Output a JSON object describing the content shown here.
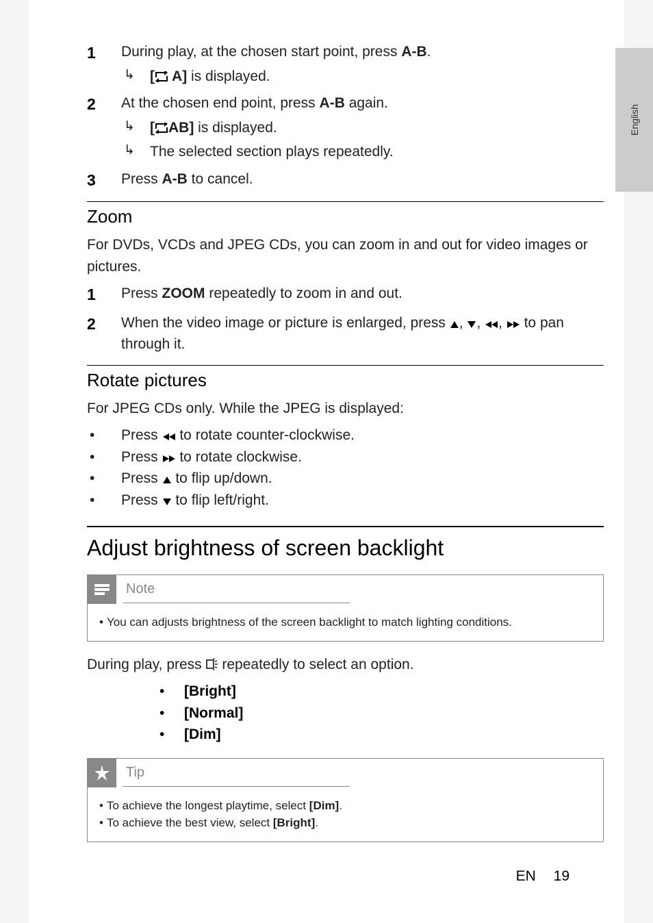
{
  "lang_tab": "English",
  "steps_a": [
    {
      "num": "1",
      "text_pre": "During play, at the chosen start point, press ",
      "text_bold": "A-B",
      "text_post": ".",
      "results": [
        {
          "pre": "[",
          "icon": "repeat",
          "mid": " A]",
          "post": " is displayed."
        }
      ]
    },
    {
      "num": "2",
      "text_pre": "At the chosen end point, press ",
      "text_bold": "A-B",
      "text_post": " again.",
      "results": [
        {
          "pre": "[",
          "icon": "repeat",
          "mid": "AB]",
          "post": " is displayed."
        },
        {
          "plain": "The selected section plays repeatedly."
        }
      ]
    },
    {
      "num": "3",
      "text_pre": "Press ",
      "text_bold": "A-B",
      "text_post": " to cancel.",
      "results": []
    }
  ],
  "zoom": {
    "heading": "Zoom",
    "intro": "For DVDs, VCDs and JPEG CDs, you can zoom in and out for video images or pictures.",
    "steps": [
      {
        "num": "1",
        "pre": "Press ",
        "bold": "ZOOM",
        "post": " repeatedly to zoom in and out."
      },
      {
        "num": "2",
        "pre": "When the video image or picture is enlarged, press ",
        "icons": true,
        "post": " to pan through it."
      }
    ]
  },
  "rotate": {
    "heading": "Rotate pictures",
    "intro": "For JPEG CDs only. While the JPEG is displayed:",
    "items": [
      {
        "pre": "Press ",
        "icon": "rew",
        "post": " to rotate counter-clockwise."
      },
      {
        "pre": "Press ",
        "icon": "ff",
        "post": " to rotate clockwise."
      },
      {
        "pre": "Press ",
        "icon": "up",
        "post": " to flip up/down."
      },
      {
        "pre": "Press ",
        "icon": "down",
        "post": " to flip left/right."
      }
    ]
  },
  "brightness": {
    "heading": "Adjust brightness of screen backlight",
    "note_label": "Note",
    "note_text": "You can adjusts brightness of the screen backlight to match lighting conditions.",
    "during": {
      "pre": "During play, press ",
      "icon": "brightness",
      "post": " repeatedly to select an option."
    },
    "options": [
      "[Bright]",
      "[Normal]",
      "[Dim]"
    ],
    "tip_label": "Tip",
    "tips": [
      {
        "pre": "To achieve the longest playtime, select ",
        "bold": "[Dim]",
        "post": "."
      },
      {
        "pre": "To achieve the best view, select ",
        "bold": "[Bright]",
        "post": "."
      }
    ]
  },
  "footer": {
    "lang": "EN",
    "page": "19"
  }
}
